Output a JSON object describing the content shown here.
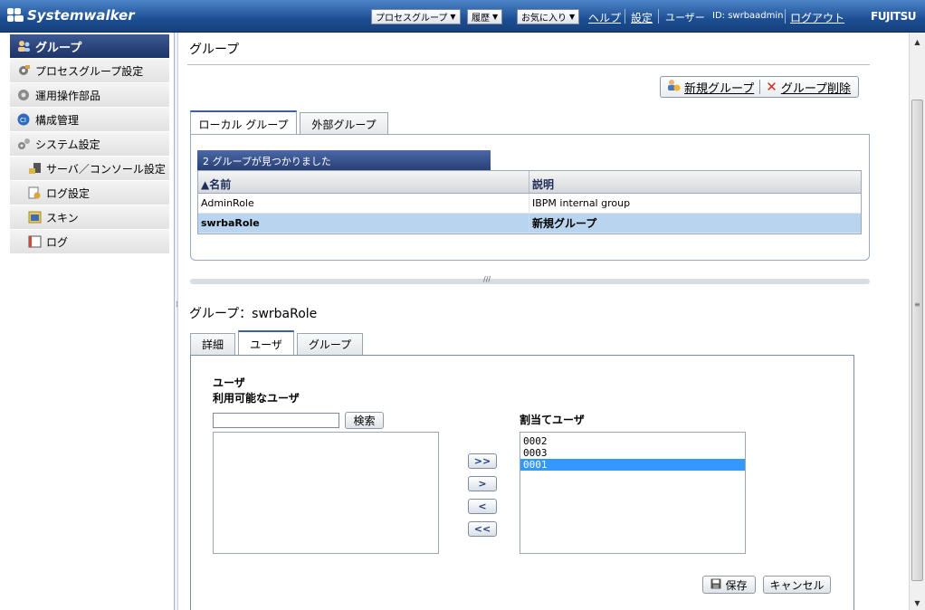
{
  "header": {
    "logo_text": "Systemwalker",
    "menu_process_group": "プロセスグループ",
    "menu_history": "履歴",
    "menu_favorites": "お気に入り",
    "link_help": "ヘルプ",
    "link_settings": "設定",
    "user_label": "ユーザー",
    "user_id": "ID: swrbaadmin",
    "link_logout": "ログアウト",
    "brand": "FUJITSU"
  },
  "sidebar": {
    "items": [
      {
        "label": "グループ",
        "icon": "group-icon"
      },
      {
        "label": "プロセスグループ設定",
        "icon": "process-group-icon"
      },
      {
        "label": "運用操作部品",
        "icon": "gear-icon"
      },
      {
        "label": "構成管理",
        "icon": "ci-icon"
      },
      {
        "label": "システム設定",
        "icon": "settings-icon"
      },
      {
        "label": "サーバ／コンソール設定",
        "icon": "server-icon"
      },
      {
        "label": "ログ設定",
        "icon": "log-settings-icon"
      },
      {
        "label": "スキン",
        "icon": "skin-icon"
      },
      {
        "label": "ログ",
        "icon": "log-icon"
      }
    ]
  },
  "main": {
    "title": "グループ",
    "new_group": "新規グループ",
    "delete_group": "グループ削除",
    "tabs": [
      "ローカル グループ",
      "外部グループ"
    ],
    "found_text": "2 グループが見つかりました",
    "columns": [
      "▲名前",
      "説明"
    ],
    "rows": [
      {
        "name": "AdminRole",
        "desc": "IBPM internal group"
      },
      {
        "name": "swrbaRole",
        "desc": "新規グループ"
      }
    ]
  },
  "detail": {
    "title": "グループ：swrbaRole",
    "tabs": [
      "詳細",
      "ユーザ",
      "グループ"
    ],
    "section_label": "ユーザ",
    "available_label": "利用可能なユーザ",
    "search_value": "",
    "search_button": "検索",
    "assigned_label": "割当てユーザ",
    "assigned_users": [
      "0002",
      "0003",
      "0001"
    ],
    "move_buttons": [
      ">>",
      ">",
      "<",
      "<<"
    ],
    "save": "保存",
    "cancel": "キャンセル"
  },
  "colors": {
    "header": "#1d4f93",
    "sidebar_active": "#2a4075",
    "selection": "#3399ff",
    "row_selected": "#b8d4ee"
  }
}
